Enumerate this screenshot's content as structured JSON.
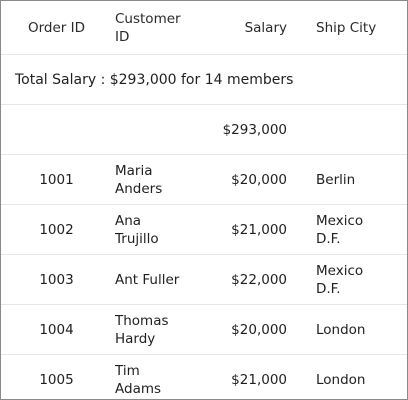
{
  "columns": {
    "order_id": "Order ID",
    "customer_id_line1": "Customer",
    "customer_id_line2": "ID",
    "salary": "Salary",
    "ship_city": "Ship City"
  },
  "group_caption": "Total Salary : $293,000 for 14 members",
  "group_summary": {
    "salary": "$293,000"
  },
  "rows": [
    {
      "order_id": "1001",
      "customer_line1": "Maria",
      "customer_line2": "Anders",
      "salary": "$20,000",
      "city_line1": "Berlin",
      "city_line2": ""
    },
    {
      "order_id": "1002",
      "customer_line1": "Ana",
      "customer_line2": "Trujillo",
      "salary": "$21,000",
      "city_line1": "Mexico",
      "city_line2": "D.F."
    },
    {
      "order_id": "1003",
      "customer_line1": "Ant Fuller",
      "customer_line2": "",
      "salary": "$22,000",
      "city_line1": "Mexico",
      "city_line2": "D.F."
    },
    {
      "order_id": "1004",
      "customer_line1": "Thomas",
      "customer_line2": "Hardy",
      "salary": "$20,000",
      "city_line1": "London",
      "city_line2": ""
    },
    {
      "order_id": "1005",
      "customer_line1": "Tim",
      "customer_line2": "Adams",
      "salary": "$21,000",
      "city_line1": "London",
      "city_line2": ""
    }
  ]
}
